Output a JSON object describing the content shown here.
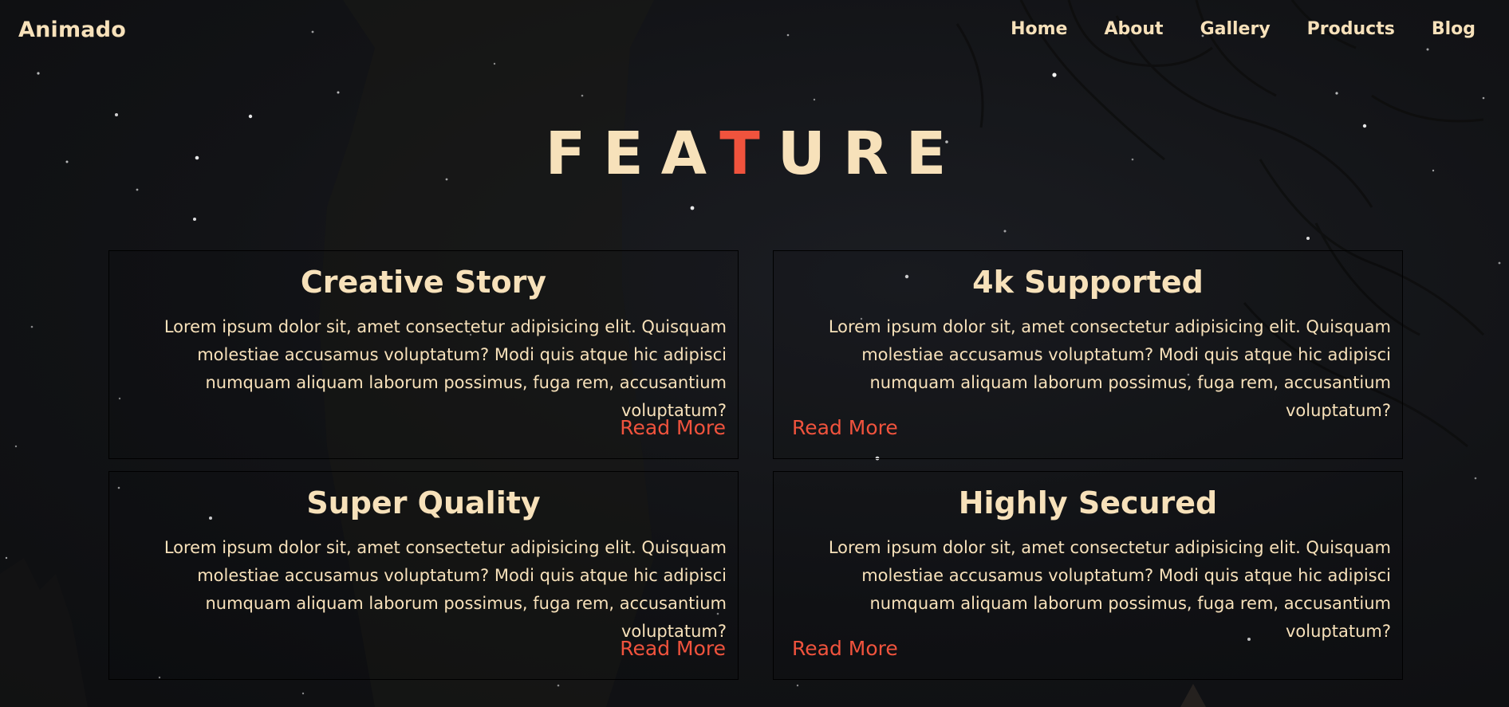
{
  "brand": "Animado",
  "nav": {
    "items": [
      {
        "label": "Home"
      },
      {
        "label": "About"
      },
      {
        "label": "Gallery"
      },
      {
        "label": "Products"
      },
      {
        "label": "Blog"
      }
    ]
  },
  "feature_title": {
    "before": "FEA",
    "highlight": "T",
    "after": "URE"
  },
  "cards": [
    {
      "title": "Creative Story",
      "text": "Lorem ipsum dolor sit, amet consectetur adipisicing elit. Quisquam molestiae accusamus voluptatum? Modi quis atque hic adipisci numquam aliquam laborum possimus, fuga rem, accusantium voluptatum?",
      "link": "Read More"
    },
    {
      "title": "4k Supported",
      "text": "Lorem ipsum dolor sit, amet consectetur adipisicing elit. Quisquam molestiae accusamus voluptatum? Modi quis atque hic adipisci numquam aliquam laborum possimus, fuga rem, accusantium voluptatum?",
      "link": "Read More"
    },
    {
      "title": "Super Quality",
      "text": "Lorem ipsum dolor sit, amet consectetur adipisicing elit. Quisquam molestiae accusamus voluptatum? Modi quis atque hic adipisci numquam aliquam laborum possimus, fuga rem, accusantium voluptatum?",
      "link": "Read More"
    },
    {
      "title": "Highly Secured",
      "text": "Lorem ipsum dolor sit, amet consectetur adipisicing elit. Quisquam molestiae accusamus voluptatum? Modi quis atque hic adipisci numquam aliquam laborum possimus, fuga rem, accusantium voluptatum?",
      "link": "Read More"
    }
  ],
  "colors": {
    "text": "#f7e1ba",
    "accent": "#f0533d",
    "background": "#121316"
  }
}
